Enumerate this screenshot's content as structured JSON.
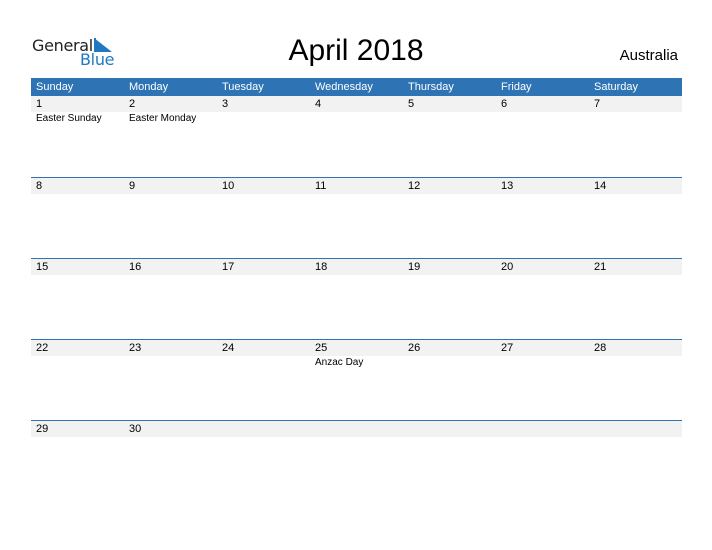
{
  "logo": {
    "word1": "General",
    "word2": "Blue"
  },
  "title": "April 2018",
  "country": "Australia",
  "weekdays": [
    "Sunday",
    "Monday",
    "Tuesday",
    "Wednesday",
    "Thursday",
    "Friday",
    "Saturday"
  ],
  "weeks": [
    [
      {
        "d": "1",
        "h": "Easter Sunday"
      },
      {
        "d": "2",
        "h": "Easter Monday"
      },
      {
        "d": "3",
        "h": ""
      },
      {
        "d": "4",
        "h": ""
      },
      {
        "d": "5",
        "h": ""
      },
      {
        "d": "6",
        "h": ""
      },
      {
        "d": "7",
        "h": ""
      }
    ],
    [
      {
        "d": "8",
        "h": ""
      },
      {
        "d": "9",
        "h": ""
      },
      {
        "d": "10",
        "h": ""
      },
      {
        "d": "11",
        "h": ""
      },
      {
        "d": "12",
        "h": ""
      },
      {
        "d": "13",
        "h": ""
      },
      {
        "d": "14",
        "h": ""
      }
    ],
    [
      {
        "d": "15",
        "h": ""
      },
      {
        "d": "16",
        "h": ""
      },
      {
        "d": "17",
        "h": ""
      },
      {
        "d": "18",
        "h": ""
      },
      {
        "d": "19",
        "h": ""
      },
      {
        "d": "20",
        "h": ""
      },
      {
        "d": "21",
        "h": ""
      }
    ],
    [
      {
        "d": "22",
        "h": ""
      },
      {
        "d": "23",
        "h": ""
      },
      {
        "d": "24",
        "h": ""
      },
      {
        "d": "25",
        "h": "Anzac Day"
      },
      {
        "d": "26",
        "h": ""
      },
      {
        "d": "27",
        "h": ""
      },
      {
        "d": "28",
        "h": ""
      }
    ],
    [
      {
        "d": "29",
        "h": ""
      },
      {
        "d": "30",
        "h": ""
      },
      {
        "d": "",
        "h": ""
      },
      {
        "d": "",
        "h": ""
      },
      {
        "d": "",
        "h": ""
      },
      {
        "d": "",
        "h": ""
      },
      {
        "d": "",
        "h": ""
      }
    ]
  ]
}
